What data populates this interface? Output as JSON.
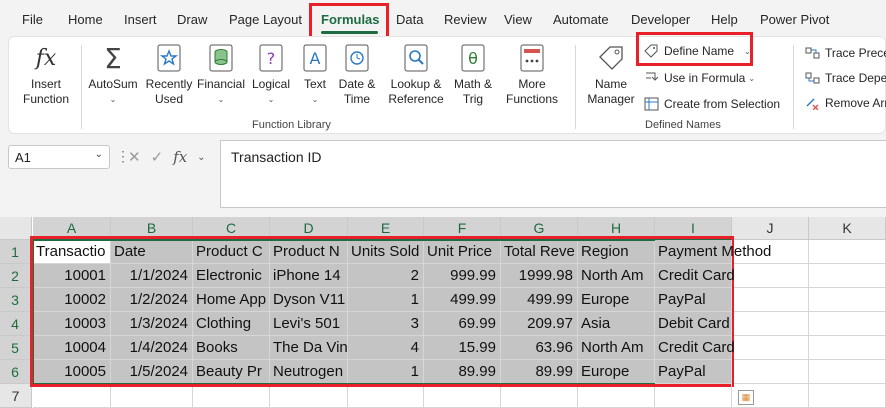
{
  "menu": {
    "tabs": [
      "File",
      "Home",
      "Insert",
      "Draw",
      "Page Layout",
      "Formulas",
      "Data",
      "Review",
      "View",
      "Automate",
      "Developer",
      "Help",
      "Power Pivot"
    ],
    "active_tab": "Formulas"
  },
  "ribbon": {
    "function_library": {
      "label": "Function Library",
      "insert_function": [
        "Insert",
        "Function"
      ],
      "autosum": "AutoSum",
      "recently_used": [
        "Recently",
        "Used"
      ],
      "financial": "Financial",
      "logical": "Logical",
      "text": "Text",
      "date_time": [
        "Date &",
        "Time"
      ],
      "lookup_reference": [
        "Lookup &",
        "Reference"
      ],
      "math_trig": [
        "Math &",
        "Trig"
      ],
      "more_functions": [
        "More",
        "Functions"
      ]
    },
    "defined_names": {
      "label": "Defined Names",
      "name_manager": [
        "Name",
        "Manager"
      ],
      "define_name": "Define Name",
      "use_in_formula": "Use in Formula",
      "create_from_selection": "Create from Selection"
    },
    "formula_auditing": {
      "trace_precedents": "Trace Preced",
      "trace_dependents": "Trace Depen",
      "remove_arrows": "Remove Arr"
    }
  },
  "formula_bar": {
    "name_box": "A1",
    "content": "Transaction ID"
  },
  "sheet": {
    "columns": [
      "A",
      "B",
      "C",
      "D",
      "E",
      "F",
      "G",
      "H",
      "I",
      "J",
      "K"
    ],
    "rows": [
      "1",
      "2",
      "3",
      "4",
      "5",
      "6",
      "7"
    ],
    "header_row": [
      "Transactio",
      "Date",
      "Product C",
      "Product N",
      "Units Sold",
      "Unit Price",
      "Total Reve",
      "Region",
      "Payment Method"
    ],
    "data_rows": [
      [
        "10001",
        "1/1/2024",
        "Electronic",
        "iPhone 14",
        "2",
        "999.99",
        "1999.98",
        "North Am",
        "Credit Card"
      ],
      [
        "10002",
        "1/2/2024",
        "Home App",
        "Dyson V11",
        "1",
        "499.99",
        "499.99",
        "Europe",
        "PayPal"
      ],
      [
        "10003",
        "1/3/2024",
        "Clothing",
        "Levi's 501",
        "3",
        "69.99",
        "209.97",
        "Asia",
        "Debit Card"
      ],
      [
        "10004",
        "1/4/2024",
        "Books",
        "The Da Vin",
        "4",
        "15.99",
        "63.96",
        "North Am",
        "Credit Card"
      ],
      [
        "10005",
        "1/5/2024",
        "Beauty Pr",
        "Neutrogen",
        "1",
        "89.99",
        "89.99",
        "Europe",
        "PayPal"
      ]
    ]
  },
  "colors": {
    "accent": "#1e6c41",
    "highlight_box": "#e8202a",
    "selection_fill": "#c4c4c4"
  }
}
